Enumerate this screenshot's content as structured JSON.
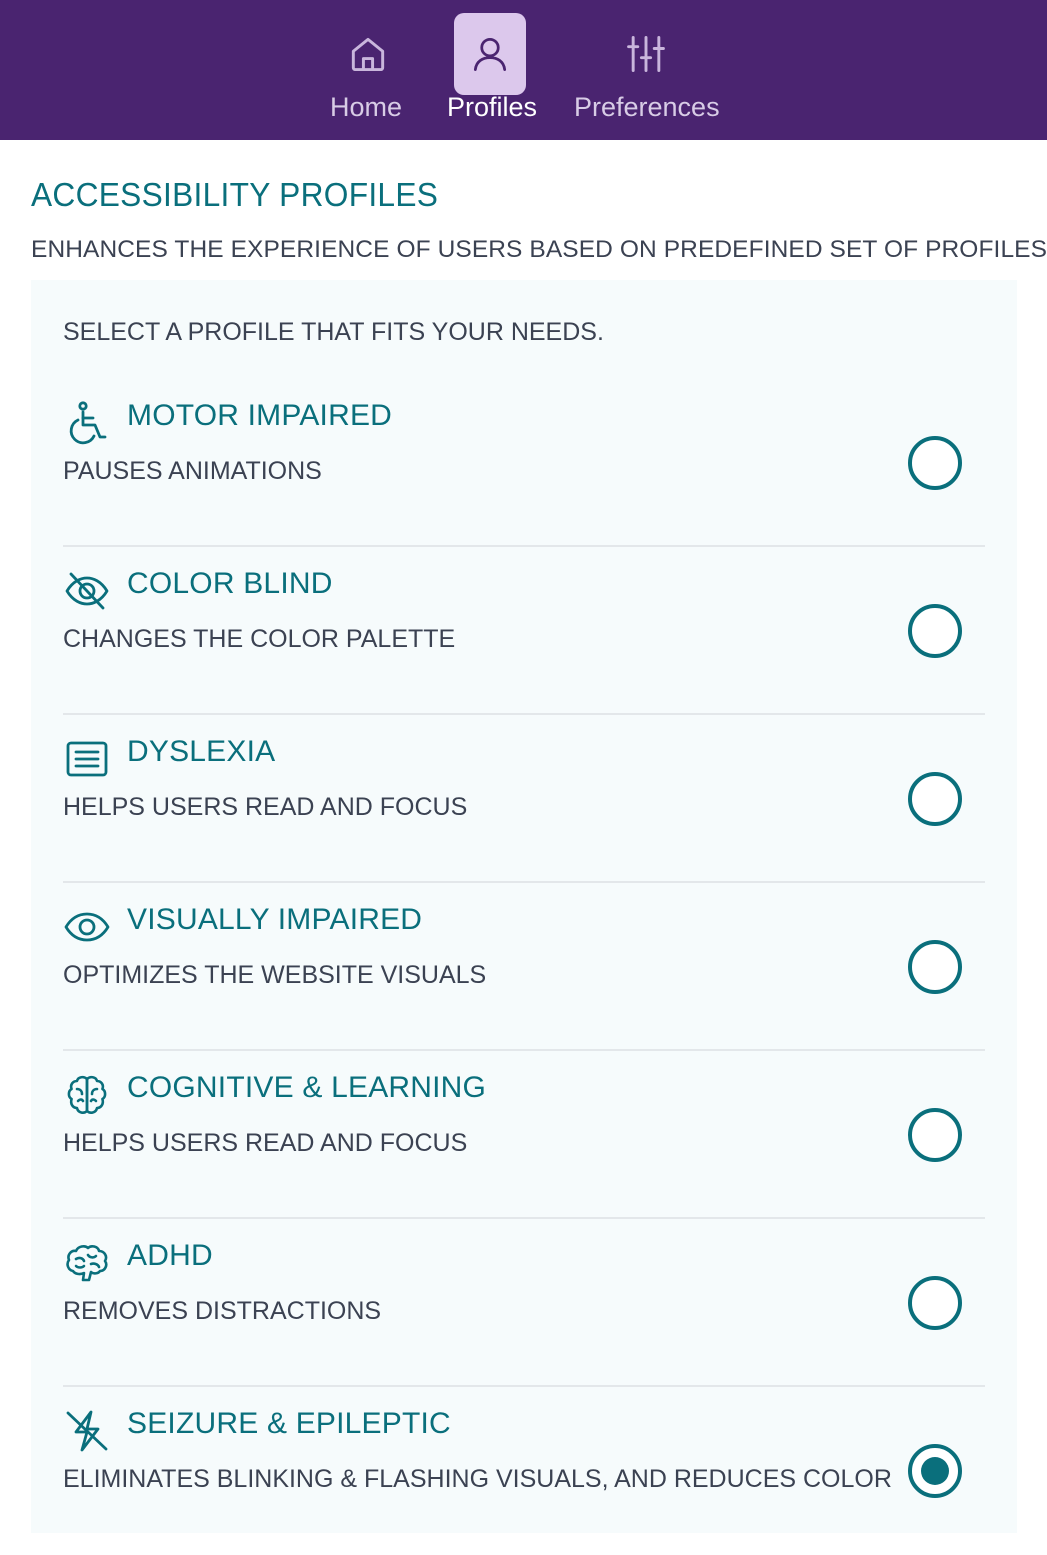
{
  "nav": {
    "tabs": [
      {
        "label": "Home",
        "icon": "home-icon",
        "active": false
      },
      {
        "label": "Profiles",
        "icon": "user-icon",
        "active": true
      },
      {
        "label": "Preferences",
        "icon": "sliders-icon",
        "active": false
      }
    ]
  },
  "page": {
    "title": "ACCESSIBILITY PROFILES",
    "subtitle": "ENHANCES THE EXPERIENCE OF USERS BASED ON PREDEFINED SET OF PROFILES."
  },
  "panel": {
    "title": "SELECT A PROFILE THAT FITS YOUR NEEDS."
  },
  "profiles": [
    {
      "title": "MOTOR IMPAIRED",
      "description": "PAUSES ANIMATIONS",
      "icon": "wheelchair-icon",
      "selected": false
    },
    {
      "title": "COLOR BLIND",
      "description": "CHANGES THE COLOR PALETTE",
      "icon": "eye-slash-icon",
      "selected": false
    },
    {
      "title": "DYSLEXIA",
      "description": "HELPS USERS READ AND FOCUS",
      "icon": "text-lines-icon",
      "selected": false
    },
    {
      "title": "VISUALLY IMPAIRED",
      "description": "OPTIMIZES THE WEBSITE VISUALS",
      "icon": "eye-icon",
      "selected": false
    },
    {
      "title": "COGNITIVE & LEARNING",
      "description": "HELPS USERS READ AND FOCUS",
      "icon": "brain-icon",
      "selected": false
    },
    {
      "title": "ADHD",
      "description": "REMOVES DISTRACTIONS",
      "icon": "brain-outline-icon",
      "selected": false
    },
    {
      "title": "SEIZURE & EPILEPTIC",
      "description": "ELIMINATES BLINKING & FLASHING VISUALS, AND REDUCES COLOR",
      "icon": "lightning-slash-icon",
      "selected": true
    }
  ],
  "colors": {
    "header_bg": "#4a2470",
    "active_tab_bg": "#dcc8ec",
    "accent": "#0a6f7c",
    "text": "#3b4252",
    "panel_bg": "#f6fbfc"
  }
}
